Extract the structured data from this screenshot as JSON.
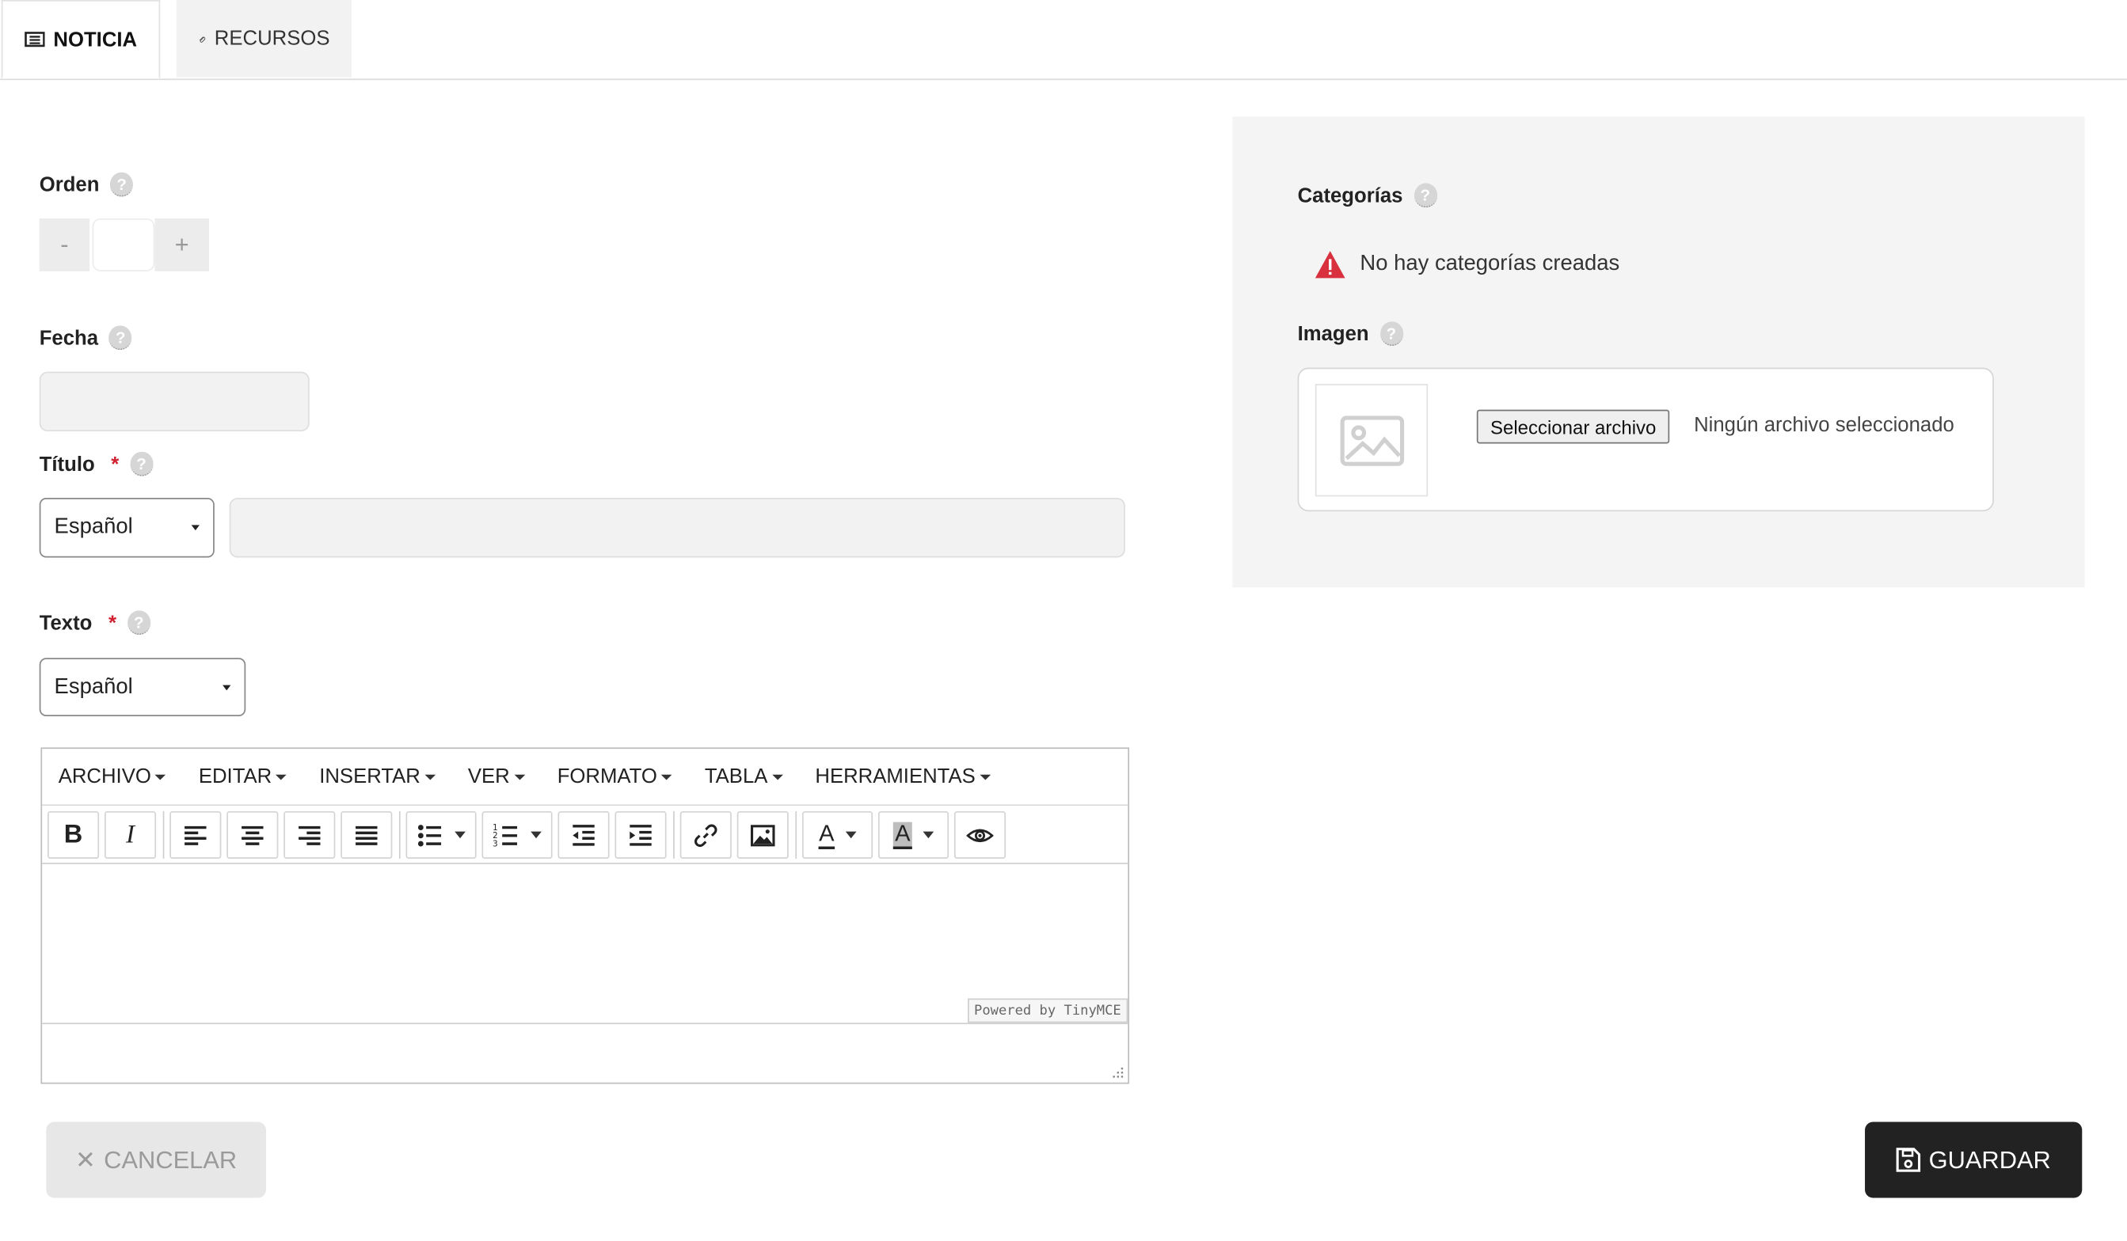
{
  "tabs": [
    {
      "label": "NOTICIA",
      "icon": "newspaper-icon",
      "active": true
    },
    {
      "label": "RECURSOS",
      "icon": "paperclip-icon",
      "active": false
    }
  ],
  "form": {
    "orden": {
      "label": "Orden",
      "minus": "-",
      "plus": "+",
      "value": ""
    },
    "fecha": {
      "label": "Fecha",
      "value": ""
    },
    "titulo": {
      "label": "Título",
      "required_mark": "*",
      "language": "Español",
      "value": ""
    },
    "texto": {
      "label": "Texto",
      "required_mark": "*",
      "language": "Español"
    },
    "help_glyph": "?"
  },
  "editor": {
    "menus": [
      "ARCHIVO",
      "EDITAR",
      "INSERTAR",
      "VER",
      "FORMATO",
      "TABLA",
      "HERRAMIENTAS"
    ],
    "toolbar": [
      "bold-icon",
      "italic-icon",
      "align-left-icon",
      "align-center-icon",
      "align-right-icon",
      "align-justify-icon",
      "bullet-list-icon",
      "numbered-list-icon",
      "outdent-icon",
      "indent-icon",
      "link-icon",
      "image-icon",
      "text-color-icon",
      "background-color-icon",
      "preview-icon"
    ],
    "bold_label": "B",
    "italic_label": "I",
    "text_color_label": "A",
    "bg_color_label": "A",
    "powered_by": "Powered by TinyMCE"
  },
  "side": {
    "categorias": {
      "label": "Categorías",
      "warning": "No hay categorías creadas"
    },
    "imagen": {
      "label": "Imagen",
      "file_button": "Seleccionar archivo",
      "file_status": "Ningún archivo seleccionado"
    }
  },
  "actions": {
    "cancel": {
      "icon": "✕",
      "label": "CANCELAR"
    },
    "save": {
      "label": "GUARDAR"
    }
  },
  "colors": {
    "accent_dark": "#222222",
    "warning": "#d9303e",
    "required": "#d0202e"
  }
}
